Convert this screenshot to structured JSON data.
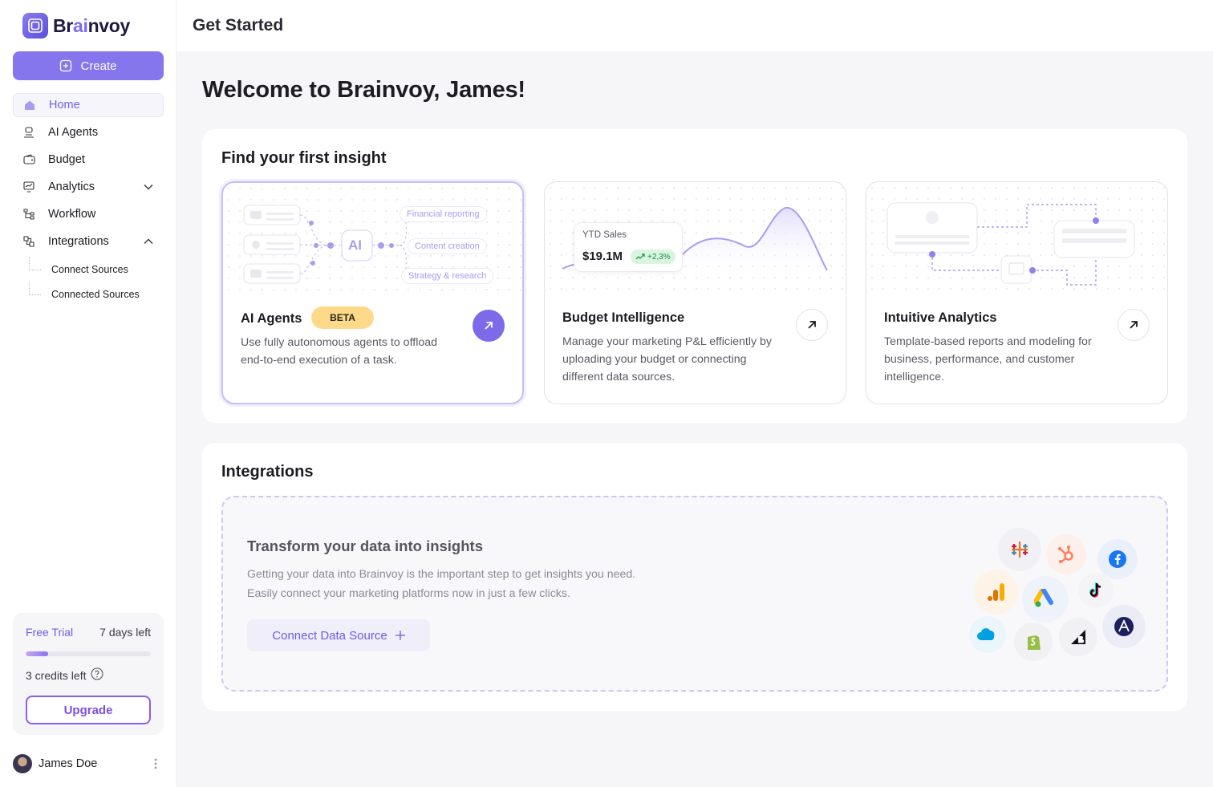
{
  "brand": {
    "name_prefix": "Br",
    "name_ai": "ai",
    "name_suffix": "nvoy"
  },
  "sidebar": {
    "create_label": "Create",
    "items": [
      {
        "label": "Home",
        "icon": "home-icon",
        "active": true
      },
      {
        "label": "AI Agents",
        "icon": "robot-icon"
      },
      {
        "label": "Budget",
        "icon": "wallet-icon"
      },
      {
        "label": "Analytics",
        "icon": "chart-icon",
        "expandable": true,
        "expanded": false
      },
      {
        "label": "Workflow",
        "icon": "workflow-icon"
      },
      {
        "label": "Integrations",
        "icon": "plug-icon",
        "expandable": true,
        "expanded": true
      }
    ],
    "sub_items": [
      {
        "label": "Connect Sources"
      },
      {
        "label": "Connected Sources"
      }
    ]
  },
  "trial": {
    "label": "Free Trial",
    "days_left": "7 days left",
    "progress": 0.18,
    "credits": "3 credits left",
    "upgrade_label": "Upgrade"
  },
  "user": {
    "name": "James Doe"
  },
  "header": {
    "title": "Get Started"
  },
  "welcome": "Welcome to Brainvoy, James!",
  "insights": {
    "title": "Find your first insight",
    "cards": [
      {
        "title": "AI Agents",
        "badge": "BETA",
        "desc": "Use fully autonomous agents to offload end-to-end execution of a task."
      },
      {
        "title": "Budget Intelligence",
        "desc": "Manage your marketing P&L efficiently by uploading your budget or connecting different data sources."
      },
      {
        "title": "Intuitive Analytics",
        "desc": "Template-based reports and modeling for business, performance, and customer intelligence."
      }
    ],
    "ai_illus": {
      "center": "AI",
      "pills": [
        "Financial reporting",
        "Content creation",
        "Strategy & research"
      ]
    },
    "budget_illus": {
      "label": "YTD Sales",
      "value": "$19.1M",
      "growth": "+2,3%"
    }
  },
  "integrations": {
    "title": "Integrations",
    "heading": "Transform your data into insights",
    "desc_line1": "Getting your data into Brainvoy is the important step to get insights you need.",
    "desc_line2": "Easily connect your marketing platforms now in just a few clicks.",
    "cta": "Connect Data Source",
    "logos": [
      "tableau-icon",
      "hubspot-icon",
      "facebook-icon",
      "google-analytics-icon",
      "google-ads-icon",
      "tiktok-icon",
      "salesforce-icon",
      "shopify-icon",
      "bigcommerce-icon",
      "appsflyer-icon"
    ]
  },
  "colors": {
    "accent": "#8576ee",
    "beta": "#ffd98a",
    "growth": "#1f8a3e"
  }
}
